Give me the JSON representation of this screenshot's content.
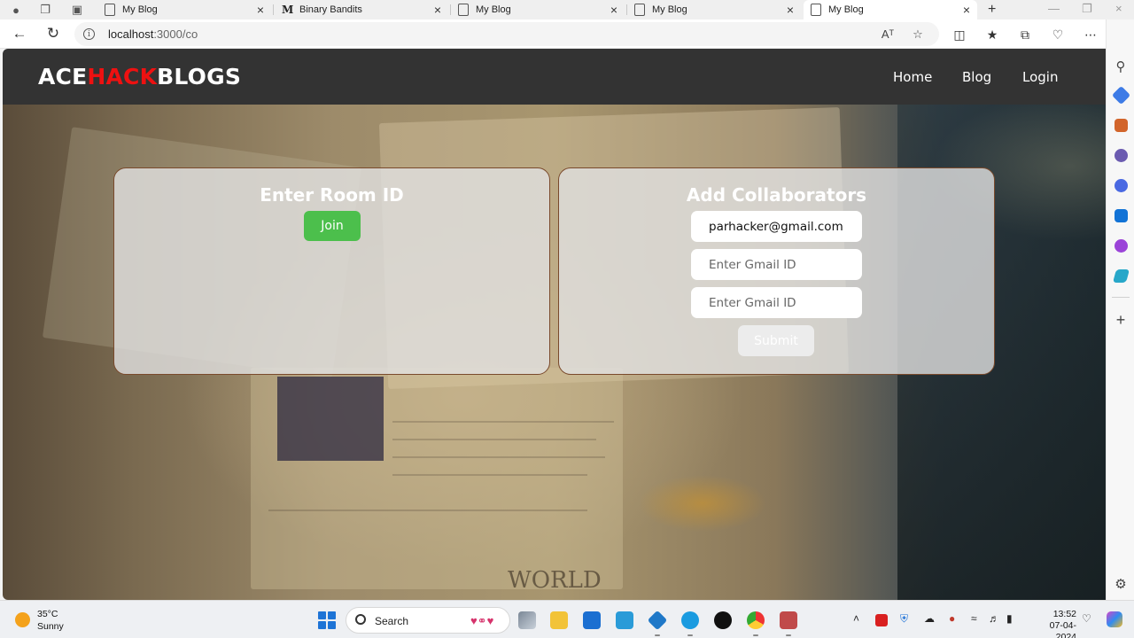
{
  "browser": {
    "tabs": [
      {
        "label": "My Blog",
        "icon": "page-icon"
      },
      {
        "label": "Binary Bandits",
        "icon": "m-logo-icon"
      },
      {
        "label": "My Blog",
        "icon": "page-icon"
      },
      {
        "label": "My Blog",
        "icon": "page-icon"
      },
      {
        "label": "My Blog",
        "icon": "page-icon",
        "active": true
      }
    ],
    "url_host": "localhost",
    "url_rest": ":3000/co"
  },
  "site": {
    "logo": {
      "part1": "ACE",
      "part2": "HACK",
      "part3": "BLOGS"
    },
    "nav": [
      {
        "label": "Home"
      },
      {
        "label": "Blog"
      },
      {
        "label": "Login"
      }
    ]
  },
  "room_card": {
    "title": "Enter Room ID",
    "join_label": "Join"
  },
  "collab_card": {
    "title": "Add Collaborators",
    "fields": [
      {
        "value": "parhacker@gmail.com",
        "placeholder": "Enter Gmail ID"
      },
      {
        "value": "",
        "placeholder": "Enter Gmail ID"
      },
      {
        "value": "",
        "placeholder": "Enter Gmail ID"
      }
    ],
    "submit_label": "Submit"
  },
  "taskbar": {
    "weather_temp": "35°C",
    "weather_cond": "Sunny",
    "search_label": "Search",
    "time": "13:52",
    "date": "07-04-2024"
  },
  "colors": {
    "header_bg": "#333333",
    "logo_accent": "#ee1111",
    "join_button": "#4cbf4c",
    "card_border": "#7a4a2c"
  }
}
